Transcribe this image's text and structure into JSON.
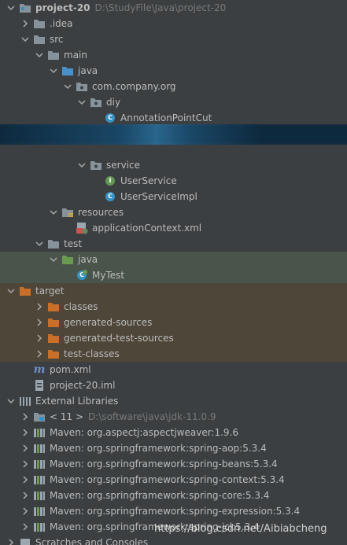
{
  "project": {
    "name": "project-20",
    "path": "D:\\StudyFile\\Java\\project-20"
  },
  "tree": {
    "idea": ".idea",
    "src": "src",
    "main": "main",
    "java": "java",
    "package": "com.company.org",
    "diy": "diy",
    "annotation_point_cut": "AnnotationPointCut",
    "service": "service",
    "user_service": "UserService",
    "user_service_impl": "UserServiceImpl",
    "resources": "resources",
    "app_context": "applicationContext.xml",
    "test": "test",
    "test_java": "java",
    "my_test": "MyTest",
    "target": "target",
    "classes": "classes",
    "generated_sources": "generated-sources",
    "generated_test_sources": "generated-test-sources",
    "test_classes": "test-classes",
    "pom": "pom.xml",
    "iml": "project-20.iml"
  },
  "external_libraries": {
    "label": "External Libraries",
    "jdk": {
      "name": "< 11 >",
      "path": "D:\\software\\java\\jdk-11.0.9"
    },
    "libs": [
      "Maven: org.aspectj:aspectjweaver:1.9.6",
      "Maven: org.springframework:spring-aop:5.3.4",
      "Maven: org.springframework:spring-beans:5.3.4",
      "Maven: org.springframework:spring-context:5.3.4",
      "Maven: org.springframework:spring-core:5.3.4",
      "Maven: org.springframework:spring-expression:5.3.4",
      "Maven: org.springframework:spring-jcl:5.3.4"
    ]
  },
  "scratches": "Scratches and Consoles",
  "watermark": "https://blog.csdn.net/Aibiabcheng",
  "colors": {
    "background": "#3c3f41",
    "selection": "#0d293e",
    "test_highlight": "#49544a",
    "target_highlight": "#4e4639",
    "text": "#bbbbbb",
    "muted": "#787878"
  }
}
